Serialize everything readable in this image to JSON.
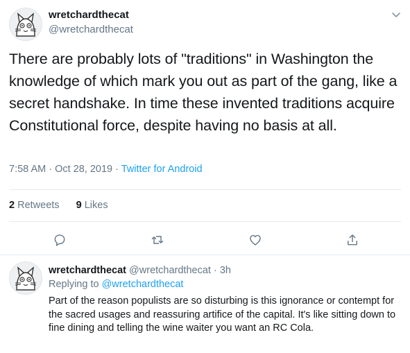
{
  "tweet": {
    "display_name": "wretchardthecat",
    "handle": "@wretchardthecat",
    "text": "There are probably lots of \"traditions\" in Washington the knowledge of which mark you out as part of the gang, like a secret handshake.  In time these invented traditions acquire Constitutional force, despite having no basis at all.",
    "time": "7:58 AM",
    "date": "Oct 28, 2019",
    "source": "Twitter for Android",
    "retweets_count": "2",
    "retweets_label": "Retweets",
    "likes_count": "9",
    "likes_label": "Likes"
  },
  "reply": {
    "display_name": "wretchardthecat",
    "handle": "@wretchardthecat",
    "time_ago": "3h",
    "replying_label": "Replying to",
    "replying_to": "@wretchardthecat",
    "text": "Part of the reason populists are so disturbing is this ignorance or contempt for the sacred usages and reassuring artifice of the capital. It's like sitting down to fine dining and telling the wine waiter you want an RC Cola."
  },
  "icons": {
    "caret": "chevron-down-icon",
    "reply": "reply-icon",
    "retweet": "retweet-icon",
    "like": "heart-icon",
    "share": "share-icon"
  },
  "colors": {
    "text": "#14171a",
    "muted": "#657786",
    "link": "#1da1f2",
    "divider": "#e6ecf0"
  }
}
